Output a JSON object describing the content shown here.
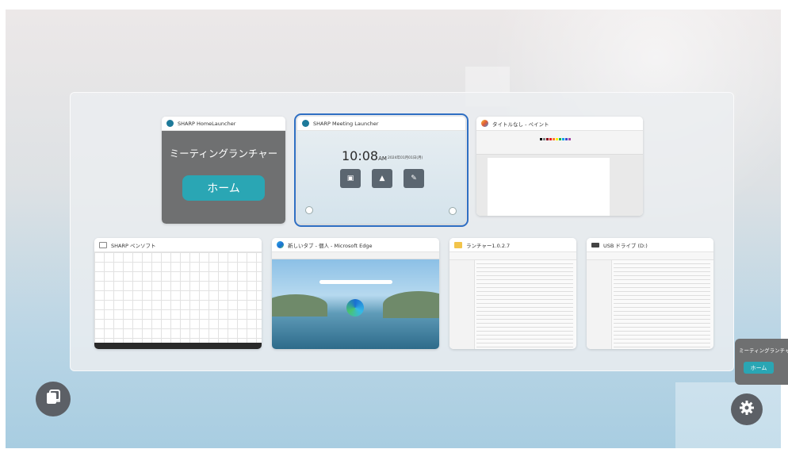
{
  "windows": [
    {
      "title": "SHARP HomeLauncher",
      "icon": "sharp-launcher-icon",
      "panel_title": "ミーティングランチャー",
      "home_button": "ホーム"
    },
    {
      "title": "SHARP Meeting Launcher",
      "icon": "sharp-launcher-icon",
      "time": "10:08",
      "ampm": "AM",
      "date": "2024年01月01日(月)",
      "selected": true
    },
    {
      "title": "タイトルなし - ペイント",
      "icon": "paint-icon"
    },
    {
      "title": "SHARP ペンソフト",
      "icon": "pencil-app-icon"
    },
    {
      "title": "新しいタブ - 個人 - Microsoft Edge",
      "icon": "edge-icon"
    },
    {
      "title": "ランチャー1.0.2.7",
      "icon": "folder-icon"
    },
    {
      "title": "USB ドライブ (D:)",
      "icon": "usb-drive-icon"
    }
  ],
  "floating_launcher": {
    "title": "ミーティングランチャー",
    "home_button": "ホーム"
  },
  "colors": {
    "accent": "#2aa6b4",
    "selection": "#2f6fc3",
    "panel_gray": "#6f7071",
    "button_gray": "#5c6066"
  },
  "icons": {
    "switch_window": "window-switch-icon",
    "settings": "gear-icon"
  }
}
